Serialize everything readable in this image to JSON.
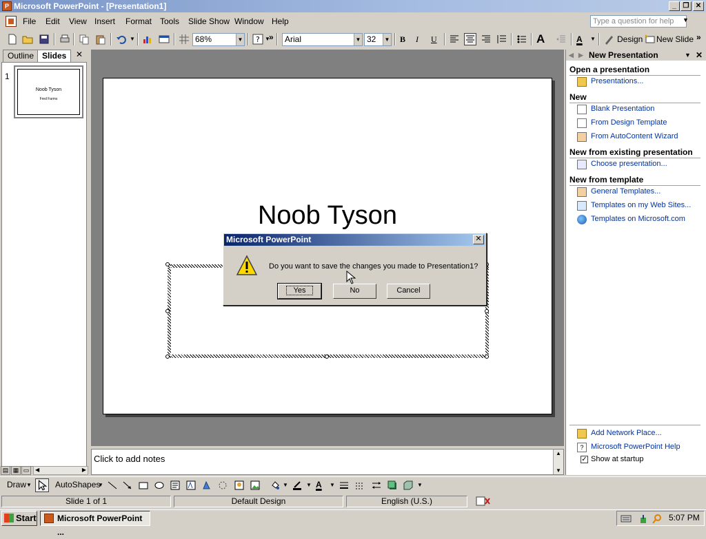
{
  "window": {
    "title": "Microsoft PowerPoint - [Presentation1]",
    "min_label": "_",
    "restore_label": "❐",
    "close_label": "✕"
  },
  "menu": {
    "items": [
      "File",
      "Edit",
      "View",
      "Insert",
      "Format",
      "Tools",
      "Slide Show",
      "Window",
      "Help"
    ],
    "help_placeholder": "Type a question for help"
  },
  "toolbar": {
    "zoom": "68%",
    "font_name": "Arial",
    "font_size": "32",
    "bold": "B",
    "italic": "I",
    "underline": "U",
    "design_label": "Design",
    "new_slide_label": "New Slide"
  },
  "left_pane": {
    "tabs": [
      "Outline",
      "Slides"
    ],
    "close_label": "✕",
    "slide_number": "1",
    "thumb_title": "Noob Tyson",
    "thumb_subtitle": "Fred Farms"
  },
  "slide": {
    "title": "Noob Tyson"
  },
  "notes": {
    "placeholder": "Click to add notes"
  },
  "task_pane": {
    "title": "New Presentation",
    "sections": {
      "open": "Open a presentation",
      "new": "New",
      "existing": "New from existing presentation",
      "template": "New from template"
    },
    "links": {
      "presentations": "Presentations...",
      "blank": "Blank Presentation",
      "design_template": "From Design Template",
      "autocontent": "From AutoContent Wizard",
      "choose": "Choose presentation...",
      "general": "General Templates...",
      "web_sites": "Templates on my Web Sites...",
      "microsoft": "Templates on Microsoft.com",
      "network": "Add Network Place...",
      "help": "Microsoft PowerPoint Help"
    },
    "show_at_startup": "Show at startup",
    "show_at_startup_checked": true
  },
  "draw_toolbar": {
    "draw_label": "Draw",
    "autoshapes_label": "AutoShapes"
  },
  "status_bar": {
    "slide": "Slide 1 of 1",
    "design": "Default Design",
    "language": "English (U.S.)"
  },
  "taskbar": {
    "start": "Start",
    "app_button": "Microsoft PowerPoint ...",
    "clock": "5:07 PM"
  },
  "dialog": {
    "title": "Microsoft PowerPoint",
    "close_label": "✕",
    "message": "Do you want to save the changes you made to Presentation1?",
    "yes": "Yes",
    "no": "No",
    "cancel": "Cancel"
  },
  "colors": {
    "dialog_title": "#0a246a",
    "link": "#0033a0",
    "window_chrome": "#d4d0c8"
  }
}
